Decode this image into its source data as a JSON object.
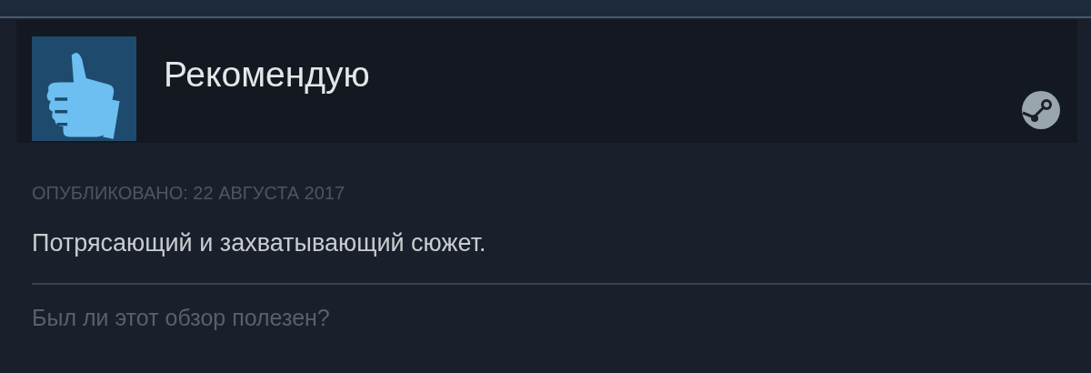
{
  "review": {
    "recommended": true,
    "verdict": "Рекомендую",
    "posted": "ОПУБЛИКОВАНО: 22 АВГУСТА 2017",
    "text": "Потрясающий и захватывающий сюжет.",
    "helpful_prompt": "Был ли этот обзор полезен?"
  }
}
